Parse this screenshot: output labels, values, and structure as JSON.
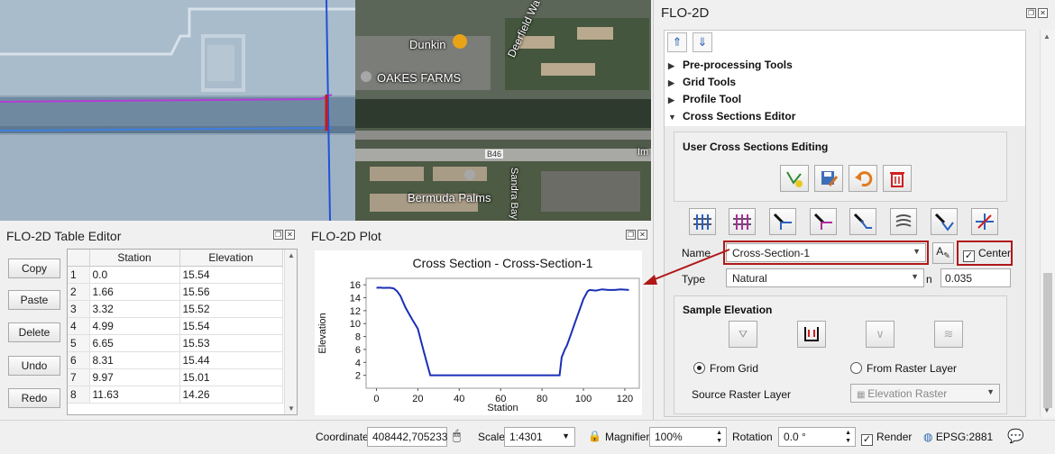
{
  "map": {
    "labels": {
      "dunkin": "Dunkin",
      "oakes_farms": "OAKES FARMS",
      "bermuda_palms": "Bermuda Palms",
      "road_deerfield": "Deerfield Wa",
      "road_sandra": "Sandra Bay",
      "route": "B46",
      "road_partial": "Im"
    }
  },
  "flo2d": {
    "title": "FLO-2D",
    "tree": {
      "preprocessing": "Pre-processing Tools",
      "grid_tools": "Grid Tools",
      "profile_tool": "Profile Tool",
      "cross_sections_editor": "Cross Sections Editor"
    },
    "user_cs_editing": "User Cross Sections Editing",
    "name_label": "Name",
    "name_value": "Cross-Section-1",
    "center_label": "Center",
    "center_checked": true,
    "type_label": "Type",
    "type_value": "Natural",
    "n_label": "n",
    "n_value": "0.035",
    "sample_elevation": "Sample Elevation",
    "from_grid": "From Grid",
    "from_raster_layer": "From Raster Layer",
    "source_raster_label": "Source Raster Layer",
    "source_raster_value": "Elevation Raster"
  },
  "table_editor": {
    "title": "FLO-2D Table Editor",
    "buttons": [
      "Copy",
      "Paste",
      "Delete",
      "Undo",
      "Redo"
    ],
    "columns": [
      "Station",
      "Elevation"
    ],
    "rows": [
      [
        "1",
        "0.0",
        "15.54"
      ],
      [
        "2",
        "1.66",
        "15.56"
      ],
      [
        "3",
        "3.32",
        "15.52"
      ],
      [
        "4",
        "4.99",
        "15.54"
      ],
      [
        "5",
        "6.65",
        "15.53"
      ],
      [
        "6",
        "8.31",
        "15.44"
      ],
      [
        "7",
        "9.97",
        "15.01"
      ],
      [
        "8",
        "11.63",
        "14.26"
      ]
    ]
  },
  "plot": {
    "panel_title": "FLO-2D Plot"
  },
  "chart_data": {
    "type": "line",
    "title": "Cross Section - Cross-Section-1",
    "xlabel": "Station",
    "ylabel": "Elevation",
    "xlim": [
      -5,
      127
    ],
    "ylim": [
      0,
      17
    ],
    "xticks": [
      0,
      20,
      40,
      60,
      80,
      100,
      120
    ],
    "yticks": [
      2,
      4,
      6,
      8,
      10,
      12,
      14,
      16
    ],
    "color": "#1a2fb5",
    "series": [
      {
        "x": [
          0,
          1.66,
          3.32,
          4.99,
          6.65,
          8.31,
          9.97,
          11.63,
          14,
          17,
          20,
          23,
          26,
          40,
          60,
          80,
          88.5,
          89.5,
          91,
          92,
          94,
          96,
          98,
          100,
          102,
          103,
          106,
          109,
          112,
          115,
          118,
          122
        ],
        "y": [
          15.54,
          15.56,
          15.52,
          15.54,
          15.53,
          15.44,
          15.01,
          14.26,
          12.5,
          10.8,
          9.2,
          5.5,
          2.0,
          2.0,
          2.0,
          2.0,
          2.0,
          4.8,
          6.0,
          6.6,
          8.4,
          10.2,
          12.0,
          13.8,
          15.0,
          15.2,
          15.1,
          15.3,
          15.2,
          15.2,
          15.3,
          15.2
        ]
      }
    ]
  },
  "status_bar": {
    "coordinate_label": "Coordinate",
    "coordinate_value": "408442,705233",
    "scale_label": "Scale",
    "scale_value": "1:4301",
    "magnifier_label": "Magnifier",
    "magnifier_value": "100%",
    "rotation_label": "Rotation",
    "rotation_value": "0.0 °",
    "render_label": "Render",
    "crs": "EPSG:2881"
  }
}
